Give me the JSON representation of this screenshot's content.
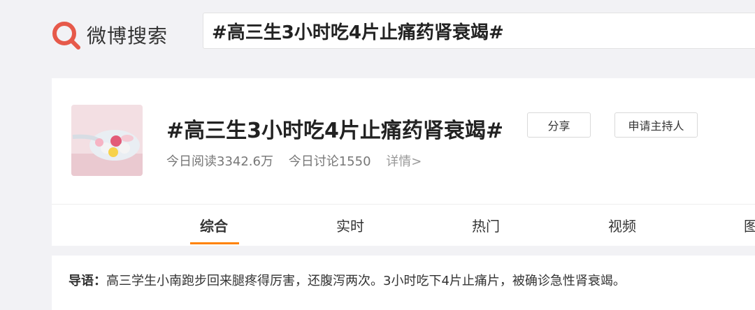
{
  "logo": {
    "text": "微博搜索",
    "accent": "#e6594a"
  },
  "search": {
    "value": "#高三生3小时吃4片止痛药肾衰竭#"
  },
  "topic": {
    "title": "#高三生3小时吃4片止痛药肾衰竭#",
    "share_label": "分享",
    "host_label": "申请主持人",
    "reads": "今日阅读3342.6万",
    "discussions": "今日讨论1550",
    "details": "详情>"
  },
  "tabs": [
    {
      "label": "综合"
    },
    {
      "label": "实时"
    },
    {
      "label": "热门"
    },
    {
      "label": "视频"
    },
    {
      "label": "图"
    }
  ],
  "guide": {
    "label": "导语：",
    "text": "高三学生小南跑步回来腿疼得厉害，还腹泻两次。3小时吃下4片止痛片，被确诊急性肾衰竭。"
  }
}
